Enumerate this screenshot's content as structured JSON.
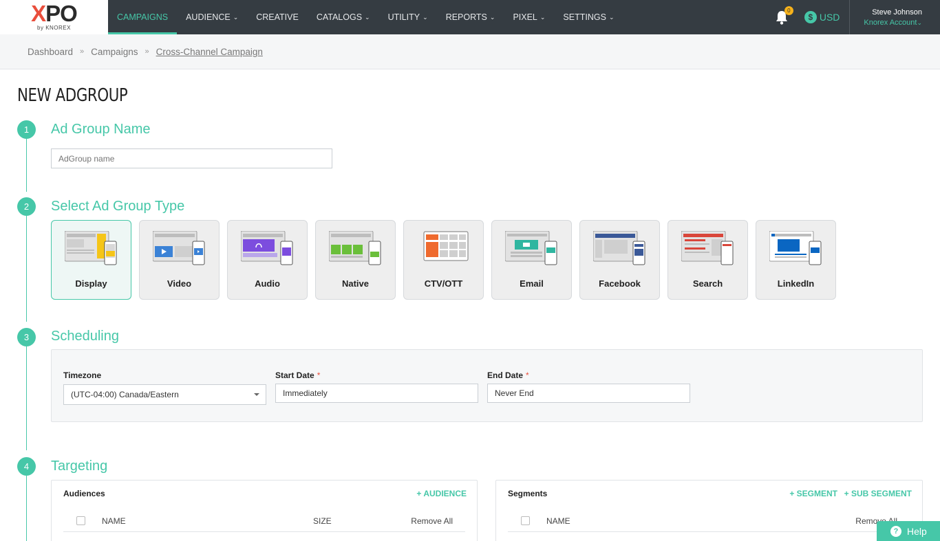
{
  "app": {
    "logo_text": "XPO",
    "logo_sub": "by KNOREX"
  },
  "nav": {
    "items": [
      {
        "label": "CAMPAIGNS",
        "has_menu": false,
        "active": true
      },
      {
        "label": "AUDIENCE",
        "has_menu": true
      },
      {
        "label": "CREATIVE",
        "has_menu": false
      },
      {
        "label": "CATALOGS",
        "has_menu": true
      },
      {
        "label": "UTILITY",
        "has_menu": true
      },
      {
        "label": "REPORTS",
        "has_menu": true
      },
      {
        "label": "PIXEL",
        "has_menu": true
      },
      {
        "label": "SETTINGS",
        "has_menu": true
      }
    ],
    "notification_count": "0",
    "currency_symbol": "$",
    "currency": "USD",
    "user_name": "Steve Johnson",
    "account": "Knorex Account"
  },
  "breadcrumb": [
    "Dashboard",
    "Campaigns",
    "Cross-Channel Campaign"
  ],
  "page_title": "NEW ADGROUP",
  "steps": [
    {
      "num": "1",
      "title": "Ad Group Name"
    },
    {
      "num": "2",
      "title": "Select Ad Group Type"
    },
    {
      "num": "3",
      "title": "Scheduling"
    },
    {
      "num": "4",
      "title": "Targeting"
    }
  ],
  "adgroup_name": {
    "placeholder": "AdGroup name",
    "value": ""
  },
  "ad_types": [
    {
      "label": "Display",
      "selected": true
    },
    {
      "label": "Video"
    },
    {
      "label": "Audio"
    },
    {
      "label": "Native"
    },
    {
      "label": "CTV/OTT"
    },
    {
      "label": "Email"
    },
    {
      "label": "Facebook"
    },
    {
      "label": "Search"
    },
    {
      "label": "LinkedIn"
    }
  ],
  "scheduling": {
    "timezone_label": "Timezone",
    "timezone_value": "(UTC-04:00) Canada/Eastern",
    "start_label": "Start Date",
    "start_value": "Immediately",
    "end_label": "End Date",
    "end_value": "Never End",
    "required_mark": "*"
  },
  "targeting": {
    "audiences": {
      "title": "Audiences",
      "add_link": "+ AUDIENCE",
      "col_name": "NAME",
      "col_size": "SIZE",
      "remove_all": "Remove All"
    },
    "segments": {
      "title": "Segments",
      "add_segment": "+ SEGMENT",
      "add_sub_segment": "+ SUB SEGMENT",
      "col_name": "NAME",
      "remove_all": "Remove All"
    }
  },
  "help": {
    "label": "Help",
    "icon": "?"
  },
  "colors": {
    "accent": "#46c7a8",
    "nav_bg": "#353c42",
    "required": "#e94e3c"
  }
}
